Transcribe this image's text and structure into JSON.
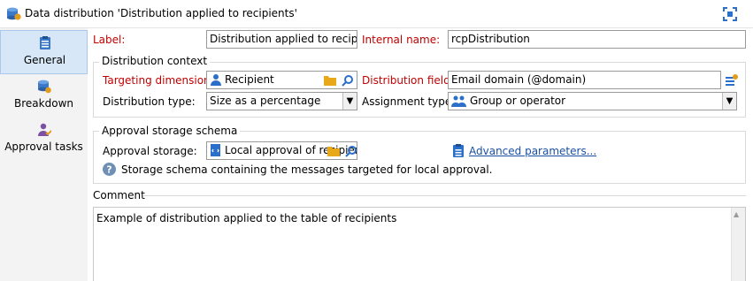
{
  "window": {
    "title": "Data distribution 'Distribution applied to recipients'",
    "icon": "data-distribution-icon",
    "maximize_icon": "maximize-icon"
  },
  "sidebar": {
    "items": [
      {
        "label": "General",
        "icon": "list-icon",
        "selected": true
      },
      {
        "label": "Breakdown",
        "icon": "database-icon",
        "selected": false
      },
      {
        "label": "Approval tasks",
        "icon": "user-check-icon",
        "selected": false
      }
    ]
  },
  "form": {
    "label_caption": "Label:",
    "label_value": "Distribution applied to recipients",
    "internal_name_caption": "Internal name:",
    "internal_name_value": "rcpDistribution"
  },
  "distribution_context": {
    "title": "Distribution context",
    "targeting_caption": "Targeting dimension:",
    "targeting_value": "Recipient",
    "distribution_field_caption": "Distribution field:",
    "distribution_field_value": "Email domain (@domain)",
    "distribution_type_caption": "Distribution type:",
    "distribution_type_value": "Size as a percentage",
    "assignment_type_caption": "Assignment type:",
    "assignment_type_value": "Group or operator"
  },
  "approval_storage": {
    "title": "Approval storage schema",
    "storage_caption": "Approval storage:",
    "storage_value": "Local approval of recipients",
    "advanced_link": "Advanced parameters...",
    "help_text": "Storage schema containing the messages targeted for local approval."
  },
  "comment": {
    "title": "Comment",
    "text": "Example of distribution applied to the table of recipients"
  },
  "colors": {
    "required_label": "#c00000",
    "link": "#1a4fa3",
    "selected_tab": "#d7e7f8",
    "accent_blue": "#2a6fc9"
  }
}
